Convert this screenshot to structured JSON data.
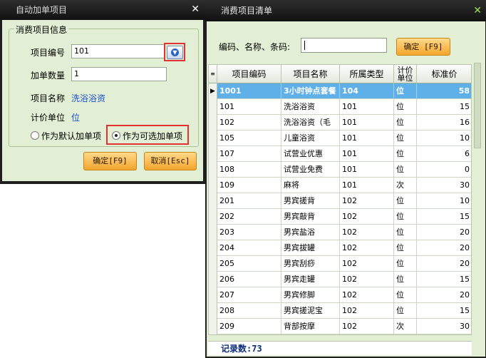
{
  "win1": {
    "title": "自动加单项目",
    "group_title": "消费项目信息",
    "item_code_label": "项目编号",
    "item_code_value": "101",
    "qty_label": "加单数量",
    "qty_value": "1",
    "name_label": "项目名称",
    "name_value": "洗浴浴资",
    "unit_label": "计价单位",
    "unit_value": "位",
    "radio_default": "作为默认加单项",
    "radio_optional": "作为可选加单项",
    "selected_radio": "optional",
    "ok_button": "确定[F9]",
    "cancel_button": "取消[Esc]"
  },
  "win2": {
    "title": "消费项目清单",
    "search_label": "编码、名称、条码:",
    "search_value": "",
    "ok_button": "确定 [F9]",
    "columns": [
      "项目编码",
      "项目名称",
      "所属类型",
      "计价单位",
      "标准价"
    ],
    "selected_row": 0,
    "rows": [
      {
        "code": "1001",
        "name": "3小时钟点套餐",
        "type": "104",
        "unit": "位",
        "price": "58"
      },
      {
        "code": "101",
        "name": "洗浴浴资",
        "type": "101",
        "unit": "位",
        "price": "15"
      },
      {
        "code": "102",
        "name": "洗浴浴资（毛",
        "type": "101",
        "unit": "位",
        "price": "16"
      },
      {
        "code": "105",
        "name": "儿童浴资",
        "type": "101",
        "unit": "位",
        "price": "10"
      },
      {
        "code": "107",
        "name": "试营业优惠",
        "type": "101",
        "unit": "位",
        "price": "6"
      },
      {
        "code": "108",
        "name": "试营业免费",
        "type": "101",
        "unit": "位",
        "price": "0"
      },
      {
        "code": "109",
        "name": "麻将",
        "type": "101",
        "unit": "次",
        "price": "30"
      },
      {
        "code": "201",
        "name": "男宾搓背",
        "type": "102",
        "unit": "位",
        "price": "10"
      },
      {
        "code": "202",
        "name": "男宾敲背",
        "type": "102",
        "unit": "位",
        "price": "15"
      },
      {
        "code": "203",
        "name": "男宾盐浴",
        "type": "102",
        "unit": "位",
        "price": "20"
      },
      {
        "code": "204",
        "name": "男宾拔罐",
        "type": "102",
        "unit": "位",
        "price": "20"
      },
      {
        "code": "205",
        "name": "男宾刮痧",
        "type": "102",
        "unit": "位",
        "price": "20"
      },
      {
        "code": "206",
        "name": "男宾走罐",
        "type": "102",
        "unit": "位",
        "price": "15"
      },
      {
        "code": "207",
        "name": "男宾修脚",
        "type": "102",
        "unit": "位",
        "price": "20"
      },
      {
        "code": "208",
        "name": "男宾搓泥宝",
        "type": "102",
        "unit": "位",
        "price": "15"
      },
      {
        "code": "209",
        "name": "背部按摩",
        "type": "102",
        "unit": "次",
        "price": "30"
      }
    ],
    "record_count_label": "记录数:73"
  }
}
